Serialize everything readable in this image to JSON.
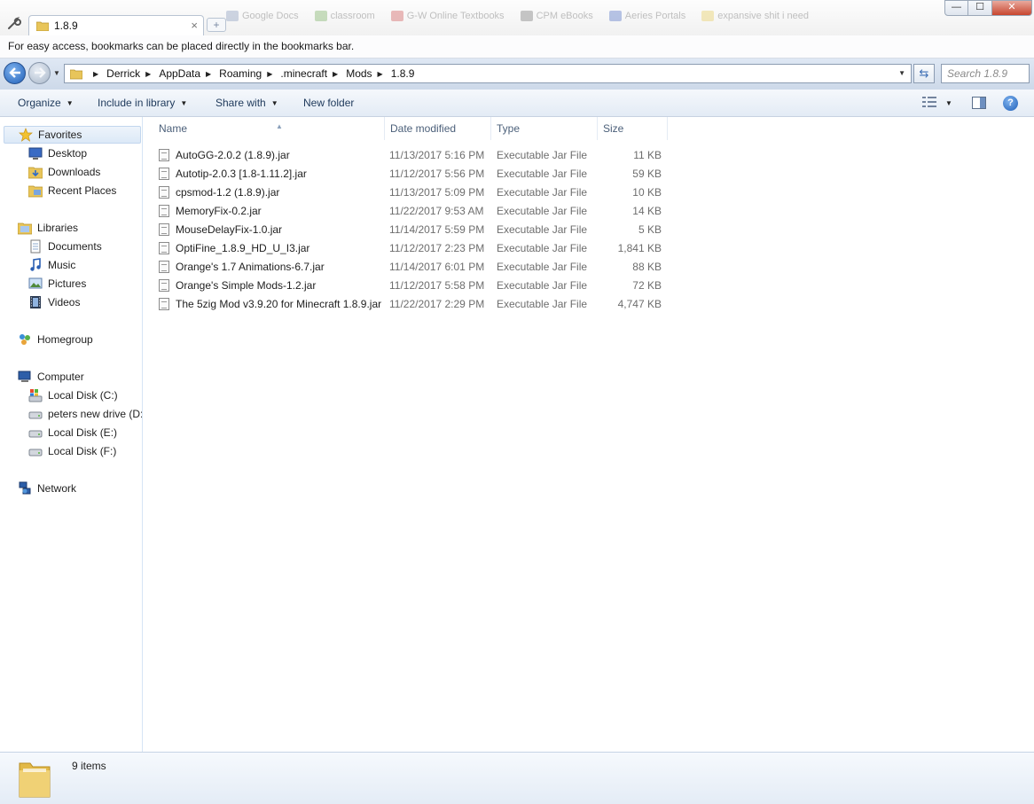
{
  "window": {
    "tab_title": "1.8.9",
    "tab_close": "×",
    "new_tab": "+",
    "faded_bookmarks": [
      "Google Docs",
      "classroom",
      "G-W Online Textbooks",
      "CPM eBooks",
      "Aeries Portals",
      "expansive shit i need"
    ],
    "min": "—",
    "max": "☐",
    "close": "✕"
  },
  "bookmark_hint": "For easy access, bookmarks can be placed directly in the bookmarks bar.",
  "address": {
    "crumbs": [
      "Derrick",
      "AppData",
      "Roaming",
      ".minecraft",
      "Mods",
      "1.8.9"
    ],
    "search_placeholder": "Search 1.8.9"
  },
  "toolbar": {
    "organize": "Organize",
    "include_library": "Include in library",
    "share_with": "Share with",
    "new_folder": "New folder"
  },
  "nav": {
    "favorites": "Favorites",
    "desktop": "Desktop",
    "downloads": "Downloads",
    "recent_places": "Recent Places",
    "libraries": "Libraries",
    "documents": "Documents",
    "music": "Music",
    "pictures": "Pictures",
    "videos": "Videos",
    "homegroup": "Homegroup",
    "computer": "Computer",
    "local_c": "Local Disk (C:)",
    "peters_d": "peters new drive (D:)",
    "local_e": "Local Disk (E:)",
    "local_f": "Local Disk (F:)",
    "network": "Network"
  },
  "columns": {
    "name": "Name",
    "date": "Date modified",
    "type": "Type",
    "size": "Size"
  },
  "files": [
    {
      "name": "AutoGG-2.0.2 (1.8.9).jar",
      "date": "11/13/2017 5:16 PM",
      "type": "Executable Jar File",
      "size": "11 KB"
    },
    {
      "name": "Autotip-2.0.3 [1.8-1.11.2].jar",
      "date": "11/12/2017 5:56 PM",
      "type": "Executable Jar File",
      "size": "59 KB"
    },
    {
      "name": "cpsmod-1.2 (1.8.9).jar",
      "date": "11/13/2017 5:09 PM",
      "type": "Executable Jar File",
      "size": "10 KB"
    },
    {
      "name": "MemoryFix-0.2.jar",
      "date": "11/22/2017 9:53 AM",
      "type": "Executable Jar File",
      "size": "14 KB"
    },
    {
      "name": "MouseDelayFix-1.0.jar",
      "date": "11/14/2017 5:59 PM",
      "type": "Executable Jar File",
      "size": "5 KB"
    },
    {
      "name": "OptiFine_1.8.9_HD_U_I3.jar",
      "date": "11/12/2017 2:23 PM",
      "type": "Executable Jar File",
      "size": "1,841 KB"
    },
    {
      "name": "Orange's 1.7 Animations-6.7.jar",
      "date": "11/14/2017 6:01 PM",
      "type": "Executable Jar File",
      "size": "88 KB"
    },
    {
      "name": "Orange's Simple Mods-1.2.jar",
      "date": "11/12/2017 5:58 PM",
      "type": "Executable Jar File",
      "size": "72 KB"
    },
    {
      "name": "The 5zig Mod v3.9.20 for Minecraft 1.8.9.jar",
      "date": "11/22/2017 2:29 PM",
      "type": "Executable Jar File",
      "size": "4,747 KB"
    }
  ],
  "status": {
    "item_count": "9 items"
  },
  "colors": {
    "accent": "#1f5fb8",
    "folder": "#e8c55a"
  }
}
